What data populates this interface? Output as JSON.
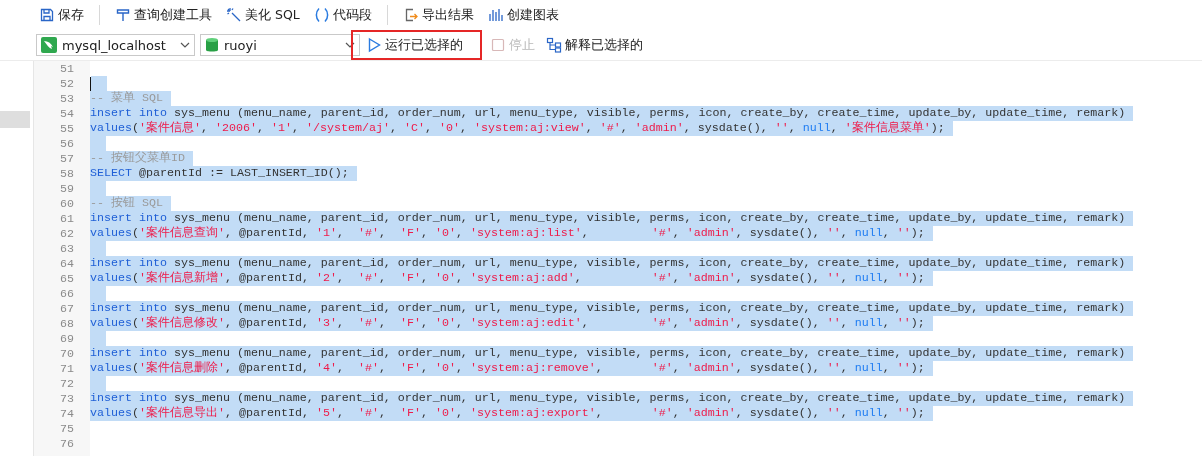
{
  "toolbar": {
    "groups": [
      [
        {
          "kind": "save",
          "label": "保存"
        }
      ],
      [
        {
          "kind": "builder",
          "label": "查询创建工具"
        },
        {
          "kind": "beautify",
          "label": "美化 SQL"
        },
        {
          "kind": "snippet",
          "label": "代码段"
        }
      ],
      [
        {
          "kind": "export",
          "label": "导出结果"
        },
        {
          "kind": "chart",
          "label": "创建图表"
        }
      ]
    ]
  },
  "connection": {
    "value": "mysql_localhost"
  },
  "database": {
    "value": "ruoyi"
  },
  "actions": [
    {
      "kind": "run",
      "label": "运行已选择的",
      "disabled": false,
      "highlighted": true
    },
    {
      "kind": "stop",
      "label": "停止",
      "disabled": true,
      "highlighted": false
    },
    {
      "kind": "explain",
      "label": "解释已选择的",
      "disabled": false,
      "highlighted": false
    }
  ],
  "editor": {
    "lines": [
      {
        "number": "51",
        "selected": false
      },
      {
        "number": "52",
        "selected": true,
        "cursor": true
      },
      {
        "number": "53",
        "selected": true,
        "tokens": [
          {
            "kind": "comment",
            "text": "-- 菜单 SQL"
          }
        ]
      },
      {
        "number": "54",
        "selected": true,
        "tokens": [
          {
            "kind": "keyword",
            "text": "insert into"
          },
          {
            "kind": "plain",
            "text": " sys_menu (menu_name, parent_id, order_num, url, menu_type, visible, perms, icon, create_by, create_time, update_by, update_time, remark)"
          }
        ]
      },
      {
        "number": "55",
        "selected": true,
        "tokens": [
          {
            "kind": "keyword",
            "text": "values"
          },
          {
            "kind": "plain",
            "text": "("
          },
          {
            "kind": "string",
            "text": "'案件信息'"
          },
          {
            "kind": "plain",
            "text": ", "
          },
          {
            "kind": "string",
            "text": "'2006'"
          },
          {
            "kind": "plain",
            "text": ", "
          },
          {
            "kind": "string",
            "text": "'1'"
          },
          {
            "kind": "plain",
            "text": ", "
          },
          {
            "kind": "string",
            "text": "'/system/aj'"
          },
          {
            "kind": "plain",
            "text": ", "
          },
          {
            "kind": "string",
            "text": "'C'"
          },
          {
            "kind": "plain",
            "text": ", "
          },
          {
            "kind": "string",
            "text": "'0'"
          },
          {
            "kind": "plain",
            "text": ", "
          },
          {
            "kind": "string",
            "text": "'system:aj:view'"
          },
          {
            "kind": "plain",
            "text": ", "
          },
          {
            "kind": "string",
            "text": "'#'"
          },
          {
            "kind": "plain",
            "text": ", "
          },
          {
            "kind": "string",
            "text": "'admin'"
          },
          {
            "kind": "plain",
            "text": ", sysdate(), "
          },
          {
            "kind": "string",
            "text": "''"
          },
          {
            "kind": "plain",
            "text": ", "
          },
          {
            "kind": "null",
            "text": "null"
          },
          {
            "kind": "plain",
            "text": ", "
          },
          {
            "kind": "string",
            "text": "'案件信息菜单'"
          },
          {
            "kind": "plain",
            "text": ");"
          }
        ]
      },
      {
        "number": "56",
        "selected": true
      },
      {
        "number": "57",
        "selected": true,
        "tokens": [
          {
            "kind": "comment",
            "text": "-- 按钮父菜单ID"
          }
        ]
      },
      {
        "number": "58",
        "selected": true,
        "tokens": [
          {
            "kind": "keyword",
            "text": "SELECT"
          },
          {
            "kind": "plain",
            "text": " @parentId := LAST_INSERT_ID();"
          }
        ]
      },
      {
        "number": "59",
        "selected": true
      },
      {
        "number": "60",
        "selected": true,
        "tokens": [
          {
            "kind": "comment",
            "text": "-- 按钮 SQL"
          }
        ]
      },
      {
        "number": "61",
        "selected": true,
        "tokens": [
          {
            "kind": "keyword",
            "text": "insert into"
          },
          {
            "kind": "plain",
            "text": " sys_menu (menu_name, parent_id, order_num, url, menu_type, visible, perms, icon, create_by, create_time, update_by, update_time, remark)"
          }
        ]
      },
      {
        "number": "62",
        "selected": true,
        "tokens": [
          {
            "kind": "keyword",
            "text": "values"
          },
          {
            "kind": "plain",
            "text": "("
          },
          {
            "kind": "string",
            "text": "'案件信息查询'"
          },
          {
            "kind": "plain",
            "text": ", @parentId, "
          },
          {
            "kind": "string",
            "text": "'1'"
          },
          {
            "kind": "plain",
            "text": ",  "
          },
          {
            "kind": "string",
            "text": "'#'"
          },
          {
            "kind": "plain",
            "text": ",  "
          },
          {
            "kind": "string",
            "text": "'F'"
          },
          {
            "kind": "plain",
            "text": ", "
          },
          {
            "kind": "string",
            "text": "'0'"
          },
          {
            "kind": "plain",
            "text": ", "
          },
          {
            "kind": "string",
            "text": "'system:aj:list'"
          },
          {
            "kind": "plain",
            "text": ",         "
          },
          {
            "kind": "string",
            "text": "'#'"
          },
          {
            "kind": "plain",
            "text": ", "
          },
          {
            "kind": "string",
            "text": "'admin'"
          },
          {
            "kind": "plain",
            "text": ", sysdate(), "
          },
          {
            "kind": "string",
            "text": "''"
          },
          {
            "kind": "plain",
            "text": ", "
          },
          {
            "kind": "null",
            "text": "null"
          },
          {
            "kind": "plain",
            "text": ", "
          },
          {
            "kind": "string",
            "text": "''"
          },
          {
            "kind": "plain",
            "text": ");"
          }
        ]
      },
      {
        "number": "63",
        "selected": true
      },
      {
        "number": "64",
        "selected": true,
        "tokens": [
          {
            "kind": "keyword",
            "text": "insert into"
          },
          {
            "kind": "plain",
            "text": " sys_menu (menu_name, parent_id, order_num, url, menu_type, visible, perms, icon, create_by, create_time, update_by, update_time, remark)"
          }
        ]
      },
      {
        "number": "65",
        "selected": true,
        "tokens": [
          {
            "kind": "keyword",
            "text": "values"
          },
          {
            "kind": "plain",
            "text": "("
          },
          {
            "kind": "string",
            "text": "'案件信息新增'"
          },
          {
            "kind": "plain",
            "text": ", @parentId, "
          },
          {
            "kind": "string",
            "text": "'2'"
          },
          {
            "kind": "plain",
            "text": ",  "
          },
          {
            "kind": "string",
            "text": "'#'"
          },
          {
            "kind": "plain",
            "text": ",  "
          },
          {
            "kind": "string",
            "text": "'F'"
          },
          {
            "kind": "plain",
            "text": ", "
          },
          {
            "kind": "string",
            "text": "'0'"
          },
          {
            "kind": "plain",
            "text": ", "
          },
          {
            "kind": "string",
            "text": "'system:aj:add'"
          },
          {
            "kind": "plain",
            "text": ",          "
          },
          {
            "kind": "string",
            "text": "'#'"
          },
          {
            "kind": "plain",
            "text": ", "
          },
          {
            "kind": "string",
            "text": "'admin'"
          },
          {
            "kind": "plain",
            "text": ", sysdate(), "
          },
          {
            "kind": "string",
            "text": "''"
          },
          {
            "kind": "plain",
            "text": ", "
          },
          {
            "kind": "null",
            "text": "null"
          },
          {
            "kind": "plain",
            "text": ", "
          },
          {
            "kind": "string",
            "text": "''"
          },
          {
            "kind": "plain",
            "text": ");"
          }
        ]
      },
      {
        "number": "66",
        "selected": true
      },
      {
        "number": "67",
        "selected": true,
        "tokens": [
          {
            "kind": "keyword",
            "text": "insert into"
          },
          {
            "kind": "plain",
            "text": " sys_menu (menu_name, parent_id, order_num, url, menu_type, visible, perms, icon, create_by, create_time, update_by, update_time, remark)"
          }
        ]
      },
      {
        "number": "68",
        "selected": true,
        "tokens": [
          {
            "kind": "keyword",
            "text": "values"
          },
          {
            "kind": "plain",
            "text": "("
          },
          {
            "kind": "string",
            "text": "'案件信息修改'"
          },
          {
            "kind": "plain",
            "text": ", @parentId, "
          },
          {
            "kind": "string",
            "text": "'3'"
          },
          {
            "kind": "plain",
            "text": ",  "
          },
          {
            "kind": "string",
            "text": "'#'"
          },
          {
            "kind": "plain",
            "text": ",  "
          },
          {
            "kind": "string",
            "text": "'F'"
          },
          {
            "kind": "plain",
            "text": ", "
          },
          {
            "kind": "string",
            "text": "'0'"
          },
          {
            "kind": "plain",
            "text": ", "
          },
          {
            "kind": "string",
            "text": "'system:aj:edit'"
          },
          {
            "kind": "plain",
            "text": ",         "
          },
          {
            "kind": "string",
            "text": "'#'"
          },
          {
            "kind": "plain",
            "text": ", "
          },
          {
            "kind": "string",
            "text": "'admin'"
          },
          {
            "kind": "plain",
            "text": ", sysdate(), "
          },
          {
            "kind": "string",
            "text": "''"
          },
          {
            "kind": "plain",
            "text": ", "
          },
          {
            "kind": "null",
            "text": "null"
          },
          {
            "kind": "plain",
            "text": ", "
          },
          {
            "kind": "string",
            "text": "''"
          },
          {
            "kind": "plain",
            "text": ");"
          }
        ]
      },
      {
        "number": "69",
        "selected": true
      },
      {
        "number": "70",
        "selected": true,
        "tokens": [
          {
            "kind": "keyword",
            "text": "insert into"
          },
          {
            "kind": "plain",
            "text": " sys_menu (menu_name, parent_id, order_num, url, menu_type, visible, perms, icon, create_by, create_time, update_by, update_time, remark)"
          }
        ]
      },
      {
        "number": "71",
        "selected": true,
        "tokens": [
          {
            "kind": "keyword",
            "text": "values"
          },
          {
            "kind": "plain",
            "text": "("
          },
          {
            "kind": "string",
            "text": "'案件信息删除'"
          },
          {
            "kind": "plain",
            "text": ", @parentId, "
          },
          {
            "kind": "string",
            "text": "'4'"
          },
          {
            "kind": "plain",
            "text": ",  "
          },
          {
            "kind": "string",
            "text": "'#'"
          },
          {
            "kind": "plain",
            "text": ",  "
          },
          {
            "kind": "string",
            "text": "'F'"
          },
          {
            "kind": "plain",
            "text": ", "
          },
          {
            "kind": "string",
            "text": "'0'"
          },
          {
            "kind": "plain",
            "text": ", "
          },
          {
            "kind": "string",
            "text": "'system:aj:remove'"
          },
          {
            "kind": "plain",
            "text": ",       "
          },
          {
            "kind": "string",
            "text": "'#'"
          },
          {
            "kind": "plain",
            "text": ", "
          },
          {
            "kind": "string",
            "text": "'admin'"
          },
          {
            "kind": "plain",
            "text": ", sysdate(), "
          },
          {
            "kind": "string",
            "text": "''"
          },
          {
            "kind": "plain",
            "text": ", "
          },
          {
            "kind": "null",
            "text": "null"
          },
          {
            "kind": "plain",
            "text": ", "
          },
          {
            "kind": "string",
            "text": "''"
          },
          {
            "kind": "plain",
            "text": ");"
          }
        ]
      },
      {
        "number": "72",
        "selected": true
      },
      {
        "number": "73",
        "selected": true,
        "tokens": [
          {
            "kind": "keyword",
            "text": "insert into"
          },
          {
            "kind": "plain",
            "text": " sys_menu (menu_name, parent_id, order_num, url, menu_type, visible, perms, icon, create_by, create_time, update_by, update_time, remark)"
          }
        ]
      },
      {
        "number": "74",
        "selected": true,
        "tokens": [
          {
            "kind": "keyword",
            "text": "values"
          },
          {
            "kind": "plain",
            "text": "("
          },
          {
            "kind": "string",
            "text": "'案件信息导出'"
          },
          {
            "kind": "plain",
            "text": ", @parentId, "
          },
          {
            "kind": "string",
            "text": "'5'"
          },
          {
            "kind": "plain",
            "text": ",  "
          },
          {
            "kind": "string",
            "text": "'#'"
          },
          {
            "kind": "plain",
            "text": ",  "
          },
          {
            "kind": "string",
            "text": "'F'"
          },
          {
            "kind": "plain",
            "text": ", "
          },
          {
            "kind": "string",
            "text": "'0'"
          },
          {
            "kind": "plain",
            "text": ", "
          },
          {
            "kind": "string",
            "text": "'system:aj:export'"
          },
          {
            "kind": "plain",
            "text": ",       "
          },
          {
            "kind": "string",
            "text": "'#'"
          },
          {
            "kind": "plain",
            "text": ", "
          },
          {
            "kind": "string",
            "text": "'admin'"
          },
          {
            "kind": "plain",
            "text": ", sysdate(), "
          },
          {
            "kind": "string",
            "text": "''"
          },
          {
            "kind": "plain",
            "text": ", "
          },
          {
            "kind": "null",
            "text": "null"
          },
          {
            "kind": "plain",
            "text": ", "
          },
          {
            "kind": "string",
            "text": "''"
          },
          {
            "kind": "plain",
            "text": ");"
          }
        ]
      },
      {
        "number": "75",
        "selected": false
      },
      {
        "number": "76",
        "selected": false
      }
    ]
  }
}
